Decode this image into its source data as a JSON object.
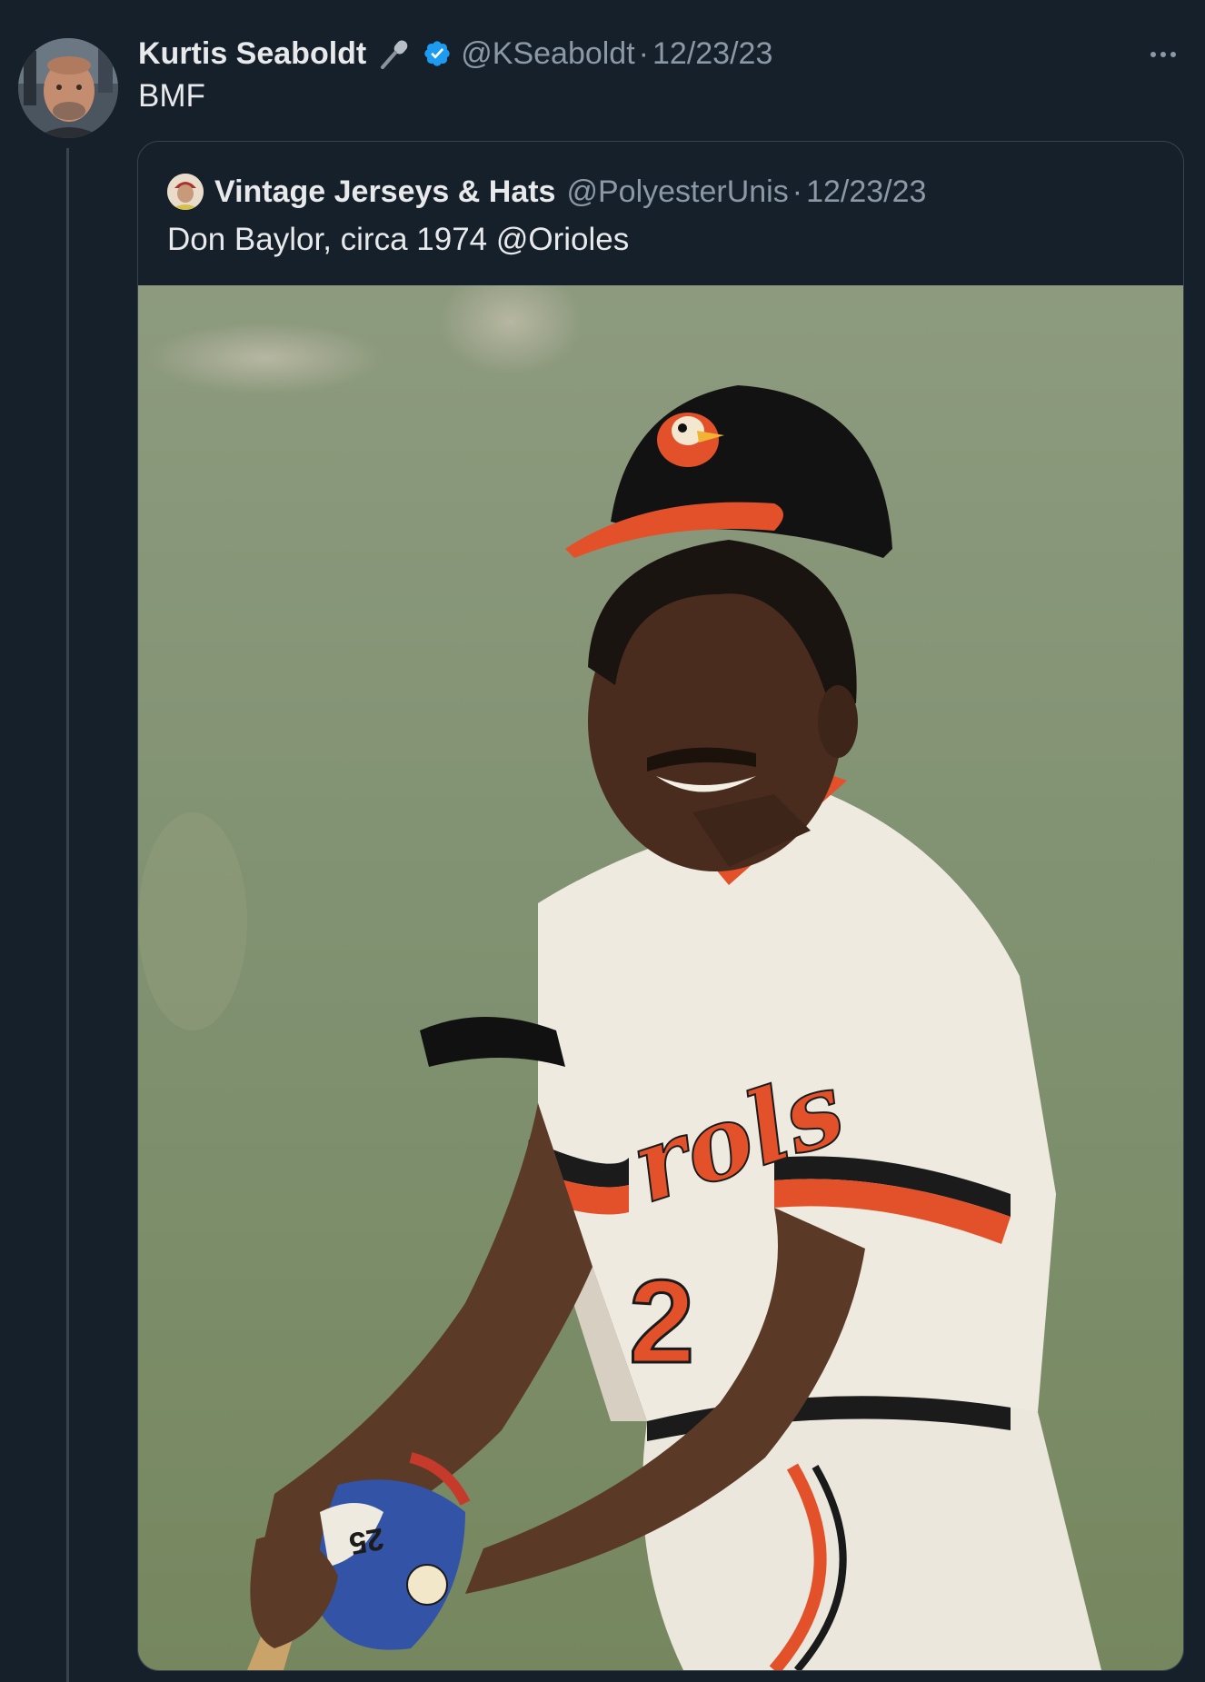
{
  "tweet": {
    "author_name": "Kurtis Seaboldt",
    "author_emoji": "🎤",
    "author_handle": "@KSeaboldt",
    "separator": "·",
    "date": "12/23/23",
    "text": "BMF",
    "more_icon": "more-icon"
  },
  "quoted_tweet": {
    "author_name": "Vintage Jerseys & Hats",
    "author_handle": "@PolyesterUnis",
    "separator": "·",
    "date": "12/23/23",
    "text": "Don Baylor, circa 1974 @Orioles",
    "image_jersey_number": "25"
  },
  "colors": {
    "background": "#15202b",
    "text_primary": "#e7e9ea",
    "text_secondary": "#8b98a5",
    "border": "#38444d",
    "verified_blue": "#1d9bf0",
    "orioles_orange": "#e2512a"
  }
}
